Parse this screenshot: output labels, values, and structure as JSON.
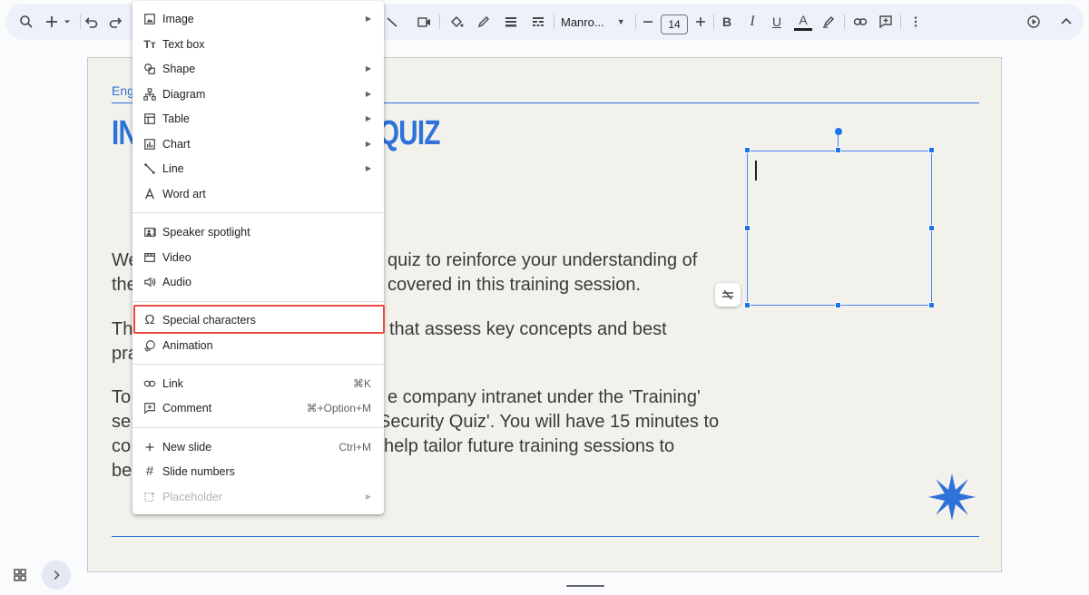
{
  "toolbar": {
    "font_name": "Manro...",
    "font_size": "14",
    "icons": [
      "search-icon",
      "add-icon",
      "dropdown-icon",
      "undo-icon",
      "redo-icon",
      "line-icon",
      "insert-video-icon",
      "fill-color-icon",
      "border-color-icon",
      "border-weight-icon",
      "border-dash-icon",
      "font-dropdown-icon",
      "decrease-size-icon",
      "increase-size-icon",
      "bold-icon",
      "italic-icon",
      "underline-icon",
      "text-color-icon",
      "highlight-icon",
      "link-icon",
      "comment-icon",
      "more-icon",
      "present-icon",
      "collapse-icon"
    ],
    "bold": "B",
    "italic": "I",
    "underline": "U",
    "text_color": "A"
  },
  "slide": {
    "tag": "Eng",
    "title_left": "IN",
    "title_right": "QUIZ",
    "p1_left": "We",
    "p1_line1_right": "quiz to reinforce your understanding of",
    "p1_line2_left": "the",
    "p1_line2_right": "covered in this training session.",
    "p2_left": "Th",
    "p2_line1_right": "that assess key concepts and best",
    "p2_line2_left": "pra",
    "p3_line1_left": "To",
    "p3_line1_right": "e company intranet under the 'Training'",
    "p3_line2_left": "se",
    "p3_line2_right": "Security Quiz'. You will have 15 minutes to",
    "p3_line3_left": "co",
    "p3_line3_right": "help tailor future training sessions to",
    "p3_line4_left": "be",
    "accent_color": "#2f72d9"
  },
  "menu": {
    "items": [
      {
        "label": "Image",
        "icon": "image-icon",
        "submenu": true
      },
      {
        "label": "Text box",
        "icon": "text-box-icon",
        "submenu": false
      },
      {
        "label": "Shape",
        "icon": "shape-icon",
        "submenu": true
      },
      {
        "label": "Diagram",
        "icon": "diagram-icon",
        "submenu": true
      },
      {
        "label": "Table",
        "icon": "table-icon",
        "submenu": true
      },
      {
        "label": "Chart",
        "icon": "chart-icon",
        "submenu": true
      },
      {
        "label": "Line",
        "icon": "line-icon",
        "submenu": true
      },
      {
        "label": "Word art",
        "icon": "word-art-icon",
        "submenu": false
      },
      {
        "label": "Speaker spotlight",
        "icon": "speaker-spotlight-icon",
        "submenu": false
      },
      {
        "label": "Video",
        "icon": "video-icon",
        "submenu": false
      },
      {
        "label": "Audio",
        "icon": "audio-icon",
        "submenu": false
      },
      {
        "label": "Special characters",
        "icon": "omega-icon",
        "submenu": false
      },
      {
        "label": "Animation",
        "icon": "animation-icon",
        "submenu": false
      },
      {
        "label": "Link",
        "icon": "link-icon",
        "shortcut": "⌘K"
      },
      {
        "label": "Comment",
        "icon": "comment-icon",
        "shortcut": "⌘+Option+M"
      },
      {
        "label": "New slide",
        "icon": "plus-icon",
        "shortcut": "Ctrl+M"
      },
      {
        "label": "Slide numbers",
        "icon": "hash-icon",
        "submenu": false
      },
      {
        "label": "Placeholder",
        "icon": "placeholder-icon",
        "submenu": true,
        "disabled": true
      }
    ],
    "highlighted": "Special characters",
    "highlight_color": "#ea4a3f"
  }
}
